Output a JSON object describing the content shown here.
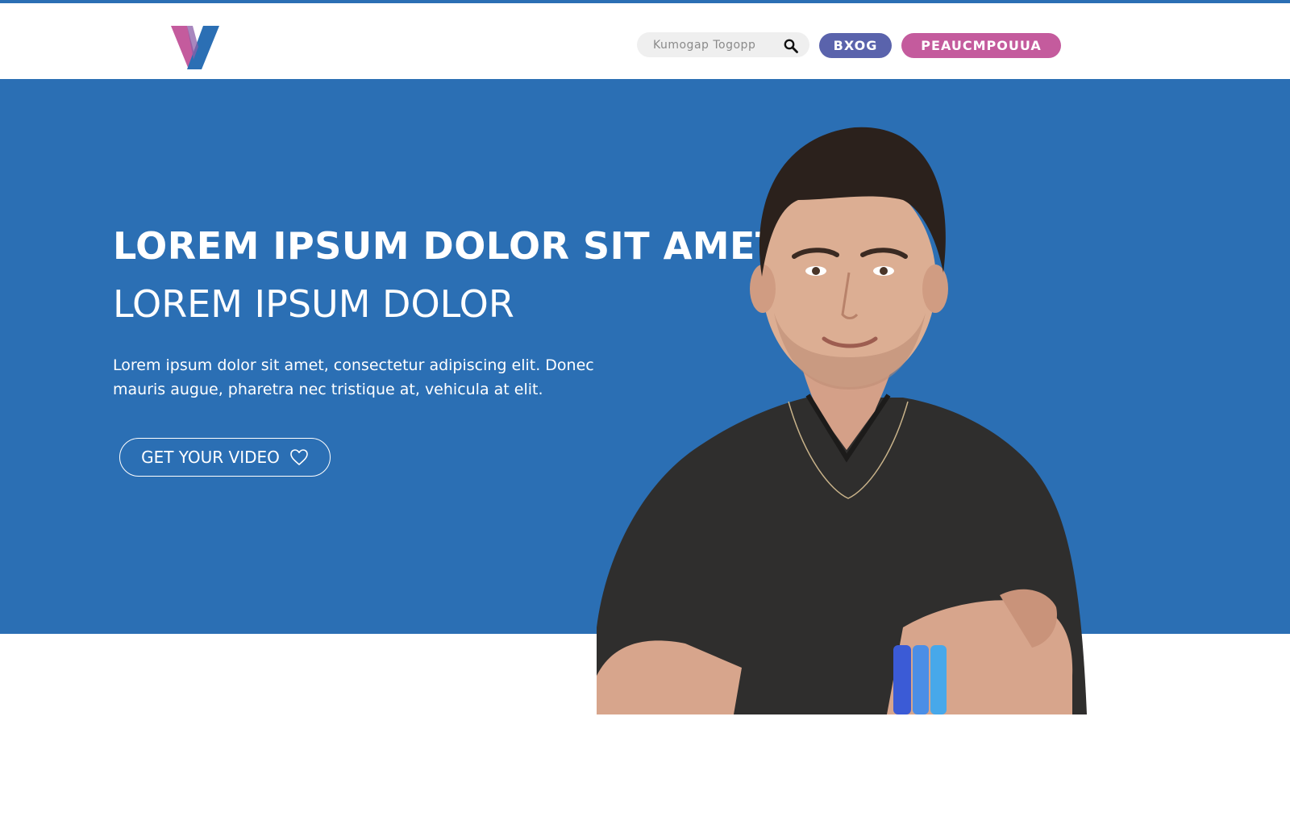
{
  "colors": {
    "accent_blue": "#2b6fb4",
    "login_button": "#5a63ac",
    "register_button": "#c45b9d",
    "logo_pink": "#c45b9d",
    "logo_blue": "#2b6fb4"
  },
  "header": {
    "logo_icon": "v-logo",
    "search": {
      "placeholder": "Kumogap Togopp",
      "icon": "search-icon"
    },
    "login_label": "BXOG",
    "register_label": "PEAUCMPOUUA"
  },
  "hero": {
    "title": "LOREM IPSUM DOLOR SIT AMET",
    "subtitle": "LOREM IPSUM DOLOR",
    "text": "Lorem ipsum dolor sit amet, consectetur adipiscing elit. Donec mauris augue, pharetra nec tristique at, vehicula at elit.",
    "cta_label": "GET YOUR VIDEO",
    "cta_icon": "heart-icon",
    "image": "smiling-man-portrait"
  }
}
